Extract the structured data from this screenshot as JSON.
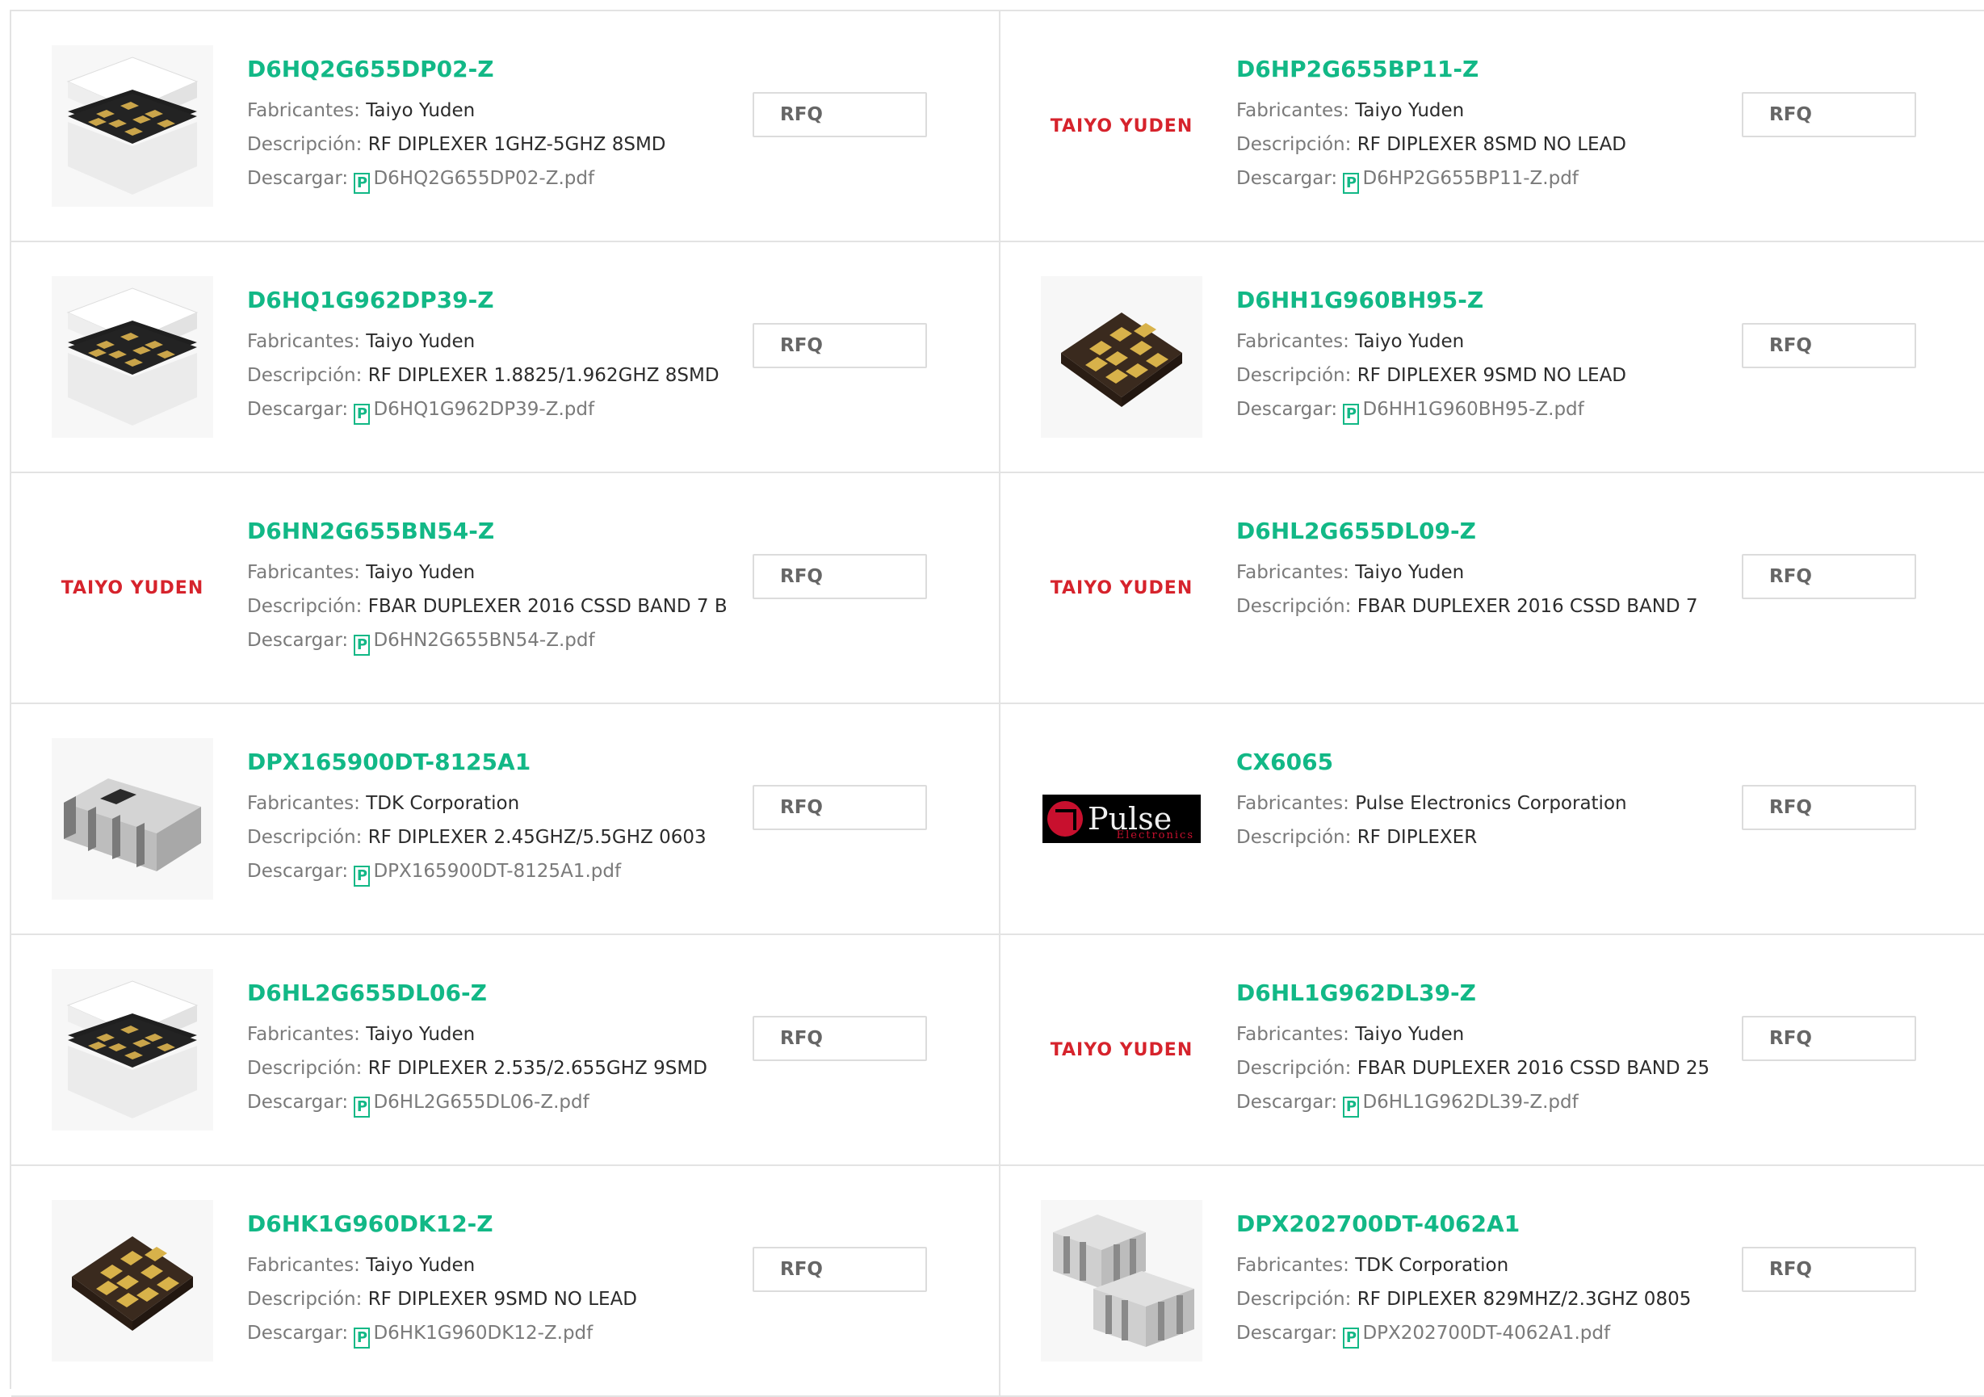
{
  "labels": {
    "manufacturer": "Fabricantes: ",
    "description": "Descripción: ",
    "download": "Descargar: ",
    "rfq": "RFQ",
    "pdf_icon_glyph": "P"
  },
  "products": [
    {
      "part": "D6HQ2G655DP02-Z",
      "manufacturer": "Taiyo Yuden",
      "description": "RF DIPLEXER 1GHZ-5GHZ 8SMD",
      "pdf": "D6HQ2G655DP02-Z.pdf",
      "image": "stacked-module"
    },
    {
      "part": "D6HP2G655BP11-Z",
      "manufacturer": "Taiyo Yuden",
      "description": "RF DIPLEXER 8SMD NO LEAD",
      "pdf": "D6HP2G655BP11-Z.pdf",
      "image": "taiyo-yuden-logo"
    },
    {
      "part": "D6HQ1G962DP39-Z",
      "manufacturer": "Taiyo Yuden",
      "description": "RF DIPLEXER 1.8825/1.962GHZ 8SMD",
      "pdf": "D6HQ1G962DP39-Z.pdf",
      "image": "stacked-module"
    },
    {
      "part": "D6HH1G960BH95-Z",
      "manufacturer": "Taiyo Yuden",
      "description": "RF DIPLEXER 9SMD NO LEAD",
      "pdf": "D6HH1G960BH95-Z.pdf",
      "image": "pad-chip"
    },
    {
      "part": "D6HN2G655BN54-Z",
      "manufacturer": "Taiyo Yuden",
      "description": "FBAR DUPLEXER 2016 CSSD BAND 7 B",
      "pdf": "D6HN2G655BN54-Z.pdf",
      "image": "taiyo-yuden-logo"
    },
    {
      "part": "D6HL2G655DL09-Z",
      "manufacturer": "Taiyo Yuden",
      "description": "FBAR DUPLEXER 2016 CSSD BAND 7",
      "pdf": null,
      "image": "taiyo-yuden-logo"
    },
    {
      "part": "DPX165900DT-8125A1",
      "manufacturer": "TDK Corporation",
      "description": "RF DIPLEXER 2.45GHZ/5.5GHZ 0603",
      "pdf": "DPX165900DT-8125A1.pdf",
      "image": "grey-chip"
    },
    {
      "part": "CX6065",
      "manufacturer": "Pulse Electronics Corporation",
      "description": "RF DIPLEXER",
      "pdf": null,
      "image": "pulse-logo"
    },
    {
      "part": "D6HL2G655DL06-Z",
      "manufacturer": "Taiyo Yuden",
      "description": "RF DIPLEXER 2.535/2.655GHZ 9SMD",
      "pdf": "D6HL2G655DL06-Z.pdf",
      "image": "stacked-module"
    },
    {
      "part": "D6HL1G962DL39-Z",
      "manufacturer": "Taiyo Yuden",
      "description": "FBAR DUPLEXER 2016 CSSD BAND 25",
      "pdf": "D6HL1G962DL39-Z.pdf",
      "image": "taiyo-yuden-logo"
    },
    {
      "part": "D6HK1G960DK12-Z",
      "manufacturer": "Taiyo Yuden",
      "description": "RF DIPLEXER 9SMD NO LEAD",
      "pdf": "D6HK1G960DK12-Z.pdf",
      "image": "pad-chip"
    },
    {
      "part": "DPX202700DT-4062A1",
      "manufacturer": "TDK Corporation",
      "description": "RF DIPLEXER 829MHZ/2.3GHZ 0805",
      "pdf": "DPX202700DT-4062A1.pdf",
      "image": "two-chips"
    }
  ],
  "logos": {
    "taiyo_yuden": "TAIYO YUDEN",
    "pulse_word": "Pulse",
    "pulse_sub": "Electronics"
  },
  "colors": {
    "link_green": "#12b886",
    "logo_red": "#d6232c",
    "border": "#e3e3e3"
  }
}
